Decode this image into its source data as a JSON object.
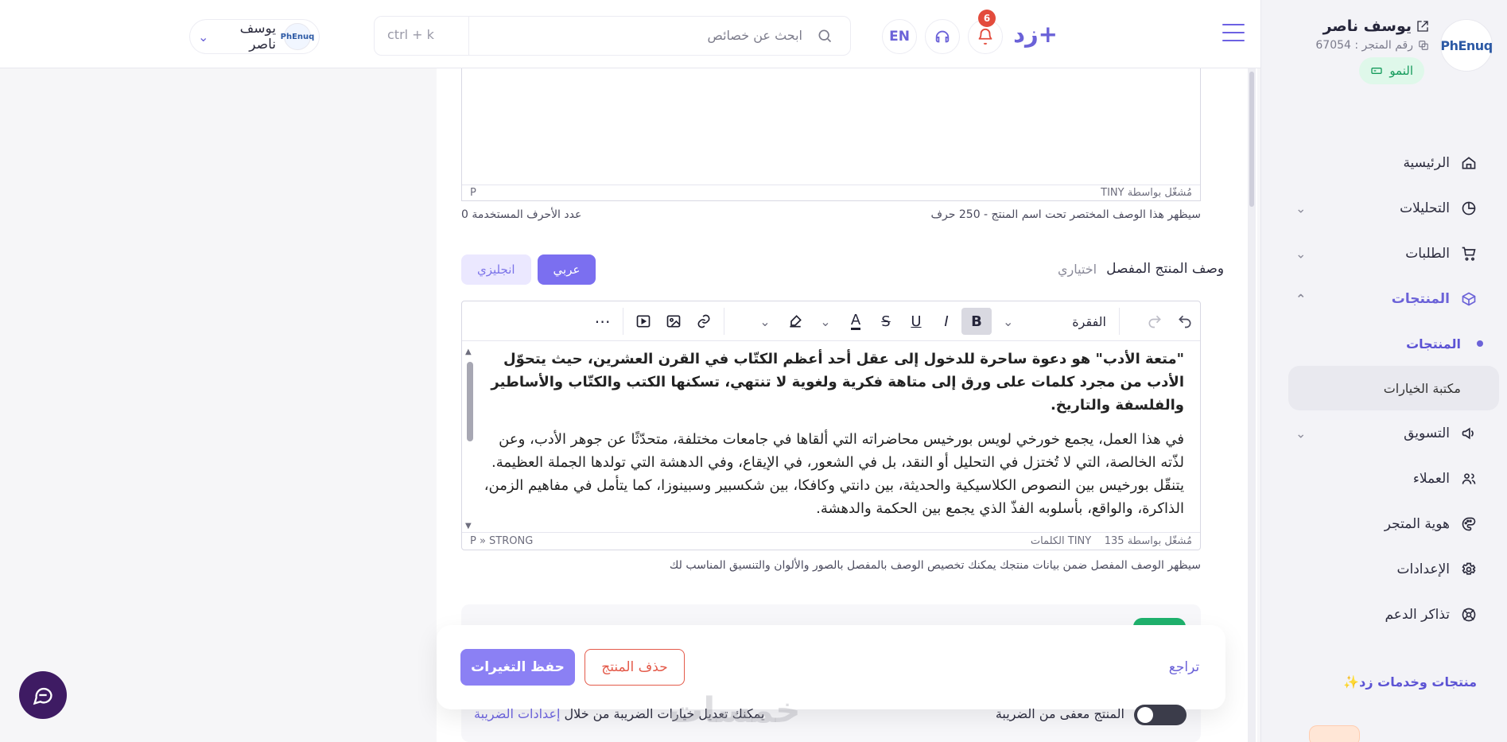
{
  "header": {
    "brand": "+زد",
    "notifications_count": "6",
    "lang_label": "EN",
    "search_placeholder": "ابحث عن خصائص",
    "search_shortcut": "ctrl + k",
    "user_name": "يوسف ناصر",
    "user_logo_text": "PhEnuq"
  },
  "sidebar": {
    "store_name": "يوسف ناصر",
    "store_number": "رقم المتجر : 67054",
    "logo_text": "PhEnuq",
    "plan": "النمو",
    "items": [
      {
        "label": "الرئيسية",
        "icon": "home-icon"
      },
      {
        "label": "التحليلات",
        "icon": "analytics-icon"
      },
      {
        "label": "الطلبات",
        "icon": "cart-icon"
      },
      {
        "label": "المنتجات",
        "icon": "box-icon"
      },
      {
        "label": "التسويق",
        "icon": "megaphone-icon"
      },
      {
        "label": "العملاء",
        "icon": "users-icon"
      },
      {
        "label": "هوية المتجر",
        "icon": "palette-icon"
      },
      {
        "label": "الإعدادات",
        "icon": "gear-icon"
      },
      {
        "label": "تذاكر الدعم",
        "icon": "lifebuoy-icon"
      }
    ],
    "sub_items": [
      {
        "label": "المنتجات"
      },
      {
        "label": "مكتبة الخيارات"
      }
    ],
    "services": "منتجات وخدمات زد✨"
  },
  "main": {
    "short_editor": {
      "path": "P",
      "powered_by": "مُشغّل بواسطة TINY",
      "hint_right": "سيظهر هذا الوصف المختصر تحت اسم المنتج - 250 حرف",
      "hint_left": "عدد الأحرف المستخدمة 0"
    },
    "detail_section": {
      "label": "وصف المنتج المفصل",
      "optional": "اختياري",
      "tab_ar": "عربي",
      "tab_en": "انجليزي",
      "paragraph_format": "الفقرة",
      "content_p1": "\"متعة الأدب\" هو دعوة ساحرة للدخول إلى عقل أحد أعظم الكتّاب في القرن العشرين، حيث يتحوّل الأدب من مجرد كلمات على ورق إلى متاهة فكرية ولغوية لا تنتهي، تسكنها الكتب والكتّاب والأساطير والفلسفة والتاريخ.",
      "content_p2": "في هذا العمل، يجمع خورخي لويس بورخيس محاضراته التي ألقاها في جامعات مختلفة، متحدّثًا عن جوهر الأدب، وعن لذّته الخالصة، التي لا تُختزل في التحليل أو النقد، بل في الشعور، في الإيقاع، وفي الدهشة التي تولدها الجملة العظيمة. يتنقّل بورخيس بين النصوص الكلاسيكية والحديثة، بين دانتي وكافكا، بين شكسبير وسبينوزا، كما يتأمل في مفاهيم الزمن، الذاكرة، والواقع، بأسلوبه الفذّ الذي يجمع بين الحكمة والدهشة.",
      "status_path": "P » STRONG",
      "word_count": "135 الكلمات",
      "powered_by": "مُشغّل بواسطة TINY",
      "hint": "سيظهر الوصف المفصل ضمن بيانات منتجك يمكنك تخصيص الوصف بالمفصل بالصور والألوان والتنسيق المناسب لك"
    },
    "actions": {
      "save": "حفظ التغيرات",
      "delete": "حذف المنتج",
      "back": "تراجع"
    },
    "tax": {
      "right_label": "المنتج معفى من الضريبة",
      "left_text": "يمكنك تعديل خيارات الضريبة من خلال",
      "left_link": "إعدادات الضريبة"
    },
    "watermark": "خمسات"
  }
}
